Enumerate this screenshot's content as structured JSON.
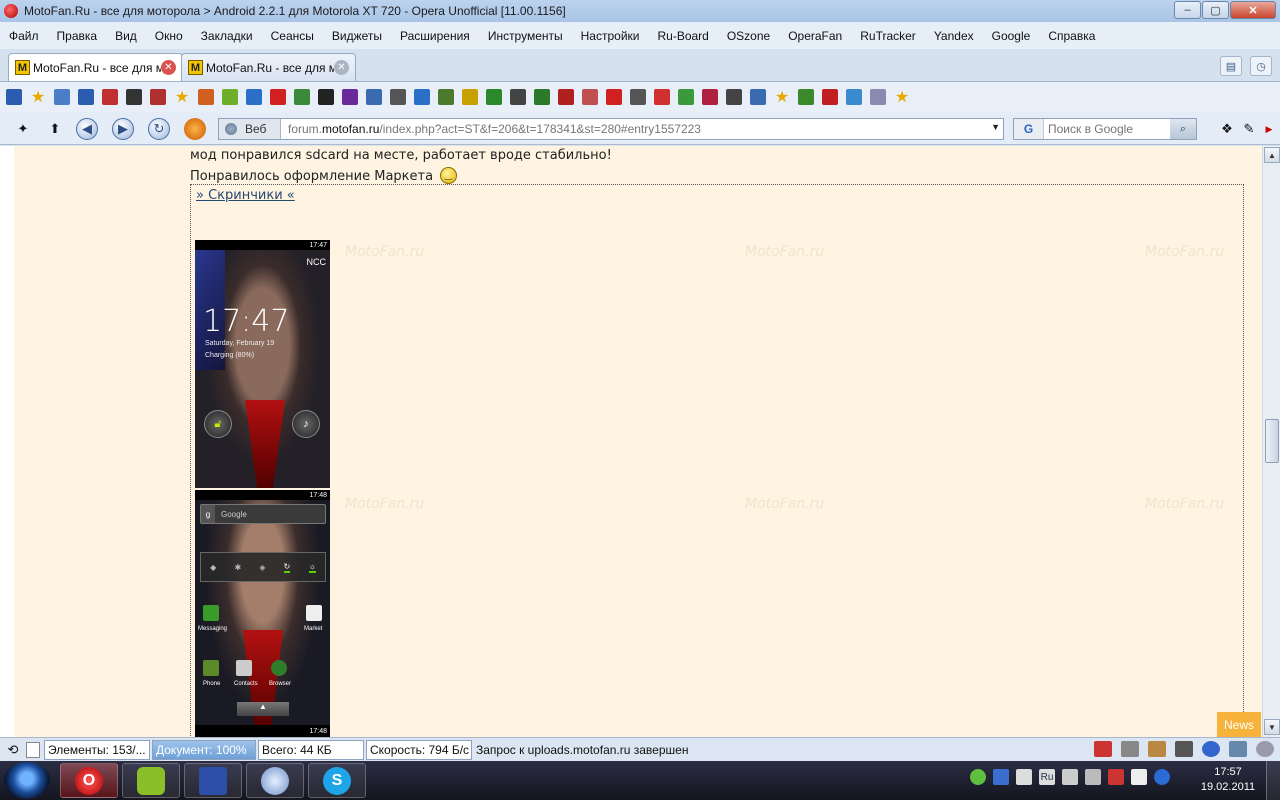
{
  "window": {
    "title": "MotoFan.Ru - все для моторола > Android 2.2.1 для Motorola XT 720 - Opera Unofficial [11.00.1156]",
    "minimize": "–",
    "maximize": "▢",
    "close": "✕"
  },
  "menu": [
    "Файл",
    "Правка",
    "Вид",
    "Окно",
    "Закладки",
    "Сеансы",
    "Виджеты",
    "Расширения",
    "Инструменты",
    "Настройки",
    "Ru-Board",
    "OSzone",
    "OperaFan",
    "RuTracker",
    "Yandex",
    "Google",
    "Справка"
  ],
  "tabs": [
    {
      "favicon": "M",
      "label": "MotoFan.Ru - все для моторола",
      "close": "✕"
    },
    {
      "favicon": "M",
      "label": "MotoFan.Ru - все для моторола",
      "close": "✕"
    }
  ],
  "bookmark_icons": [
    "bookmark-1-icon",
    "star-icon",
    "bookmark-3-icon",
    "bookmark-4-icon",
    "ebay-icon",
    "bookmark-6-icon",
    "xda-icon",
    "star-icon",
    "basketball-icon",
    "android-icon",
    "bookmark-11-icon",
    "opera-icon",
    "bookmark-13-icon",
    "shield-icon",
    "lmgtfy-icon",
    "bookmark-16-icon",
    "bookmark-17-icon",
    "bookmark-18-icon",
    "bookmark-19-icon",
    "flac-music-icon",
    "rasta-icon",
    "cube-icon",
    "bookmark-23-icon",
    "qr-icon",
    "bookmark-25-icon",
    "youtube-icon",
    "q-icon",
    "bookmark-28-icon",
    "bookmark-29-icon",
    "bookmark-30-icon",
    "bookmark-31-icon",
    "bookmark-32-icon",
    "star-icon",
    "bookmark-34-icon",
    "bookmark-35-icon",
    "bookmark-36-icon",
    "bookmark-37-icon",
    "star-icon"
  ],
  "address": {
    "site_label": "Веб",
    "url_prefix": "forum.",
    "url_domain": "motofan.ru",
    "url_rest": "/index.php?act=ST&f=206&t=178341&st=280#entry1557223",
    "search_placeholder": "Поиск в Google",
    "search_engine": "G"
  },
  "page": {
    "line1": "мод понравился sdcard на месте, работает вроде стабильно!",
    "line2": "Понравилось оформление Маркета",
    "spoiler": "» Скринчики «",
    "watermark": "MotoFan.ru",
    "lock_screen": {
      "status_time": "17:47",
      "carrier": "NCC",
      "clock": "17:47",
      "date": "Saturday, February 19",
      "charging": "Charging (80%)"
    },
    "home_screen": {
      "status_time": "17:48",
      "search_hint": "Google",
      "apps": [
        "Messaging",
        "Market",
        "Phone",
        "Contacts",
        "Browser"
      ]
    },
    "next_status_time": "17:48",
    "news_badge": "News"
  },
  "statusbar": {
    "elements": "Элементы:   153/...",
    "document": "Документ:   100%",
    "total": "Всего:   44 КБ",
    "speed": "Скорость:   794 Б/с",
    "message": "Запрос к uploads.motofan.ru завершен"
  },
  "taskbar": {
    "lang": "Ru",
    "time": "17:57",
    "date": "19.02.2011"
  }
}
